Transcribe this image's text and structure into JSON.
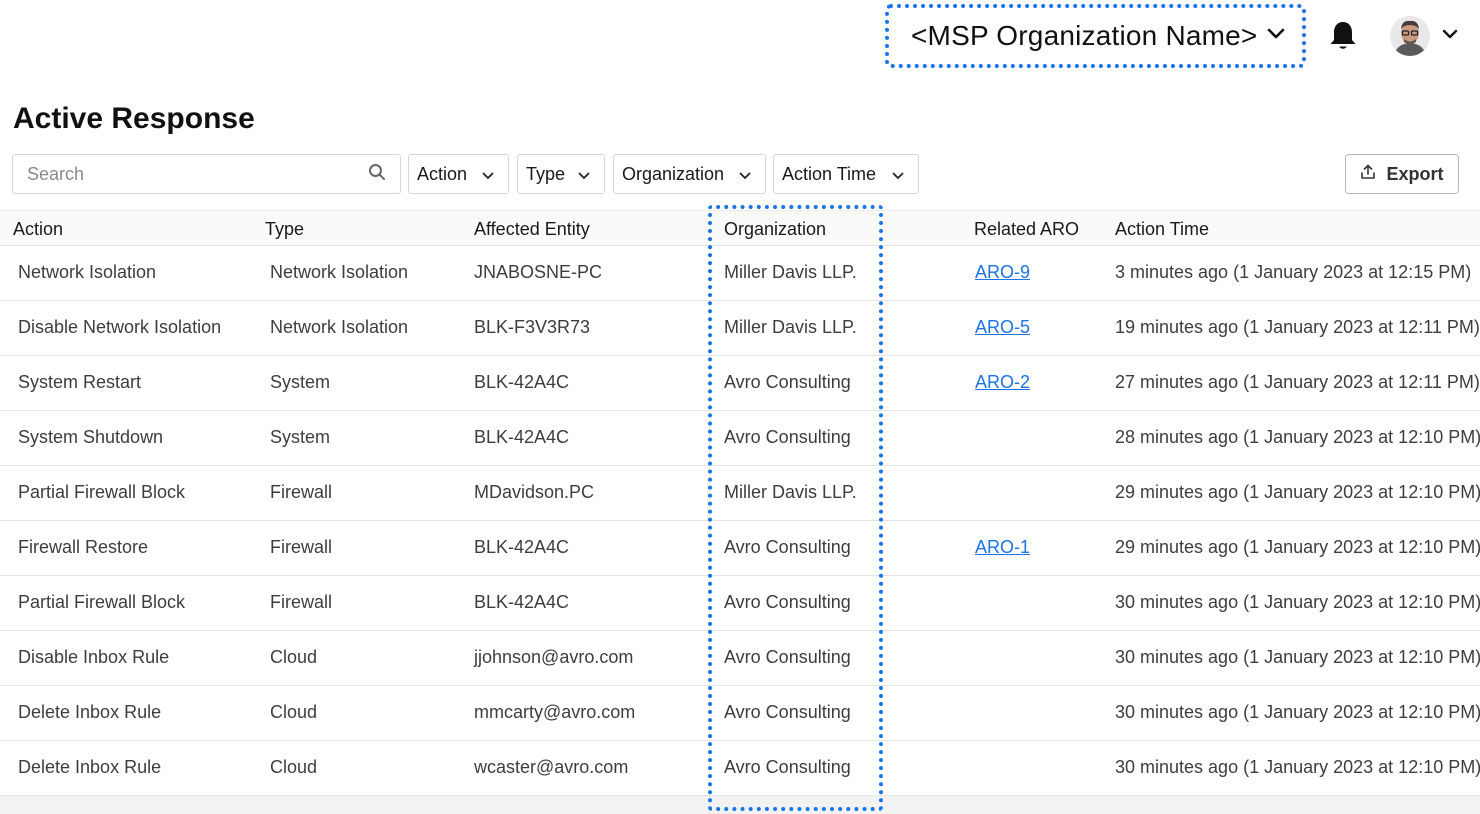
{
  "header": {
    "org_switcher_label": "<MSP Organization Name>",
    "notification_icon": "bell-icon",
    "avatar_icon": "user-avatar"
  },
  "page": {
    "title": "Active Response"
  },
  "filters": {
    "search_placeholder": "Search",
    "action_label": "Action",
    "type_label": "Type",
    "organization_label": "Organization",
    "action_time_label": "Action Time",
    "export_label": "Export"
  },
  "colors": {
    "accent": "#1a73e8",
    "link": "#1a73e8"
  },
  "table": {
    "columns": [
      "Action",
      "Type",
      "Affected Entity",
      "Organization",
      "Related ARO",
      "Action Time"
    ],
    "rows": [
      {
        "action": "Network Isolation",
        "type": "Network Isolation",
        "entity": "JNABOSNE-PC",
        "org": "Miller Davis LLP.",
        "aro": "ARO-9",
        "time": "3 minutes ago (1 January 2023 at 12:15 PM)"
      },
      {
        "action": "Disable Network Isolation",
        "type": "Network Isolation",
        "entity": "BLK-F3V3R73",
        "org": "Miller Davis LLP.",
        "aro": "ARO-5",
        "time": "19 minutes ago (1 January 2023 at 12:11 PM)"
      },
      {
        "action": "System Restart",
        "type": "System",
        "entity": "BLK-42A4C",
        "org": "Avro Consulting",
        "aro": "ARO-2",
        "time": "27 minutes ago (1 January 2023 at 12:11 PM)"
      },
      {
        "action": "System Shutdown",
        "type": "System",
        "entity": "BLK-42A4C",
        "org": "Avro Consulting",
        "aro": "",
        "time": "28 minutes ago (1 January 2023 at 12:10 PM)"
      },
      {
        "action": "Partial Firewall Block",
        "type": "Firewall",
        "entity": "MDavidson.PC",
        "org": "Miller Davis LLP.",
        "aro": "",
        "time": "29 minutes ago (1 January 2023 at 12:10 PM)"
      },
      {
        "action": "Firewall Restore",
        "type": "Firewall",
        "entity": "BLK-42A4C",
        "org": "Avro Consulting",
        "aro": "ARO-1",
        "time": "29 minutes ago (1 January 2023 at 12:10 PM)"
      },
      {
        "action": "Partial Firewall Block",
        "type": "Firewall",
        "entity": "BLK-42A4C",
        "org": "Avro Consulting",
        "aro": "",
        "time": "30 minutes ago (1 January 2023 at 12:10 PM)"
      },
      {
        "action": "Disable Inbox Rule",
        "type": "Cloud",
        "entity": "jjohnson@avro.com",
        "org": "Avro Consulting",
        "aro": "",
        "time": "30 minutes ago (1 January 2023 at 12:10 PM)"
      },
      {
        "action": "Delete Inbox Rule",
        "type": "Cloud",
        "entity": "mmcarty@avro.com",
        "org": "Avro Consulting",
        "aro": "",
        "time": "30 minutes ago (1 January 2023 at 12:10 PM)"
      },
      {
        "action": "Delete Inbox Rule",
        "type": "Cloud",
        "entity": "wcaster@avro.com",
        "org": "Avro Consulting",
        "aro": "",
        "time": "30 minutes ago (1 January 2023 at 12:10 PM)"
      }
    ]
  }
}
